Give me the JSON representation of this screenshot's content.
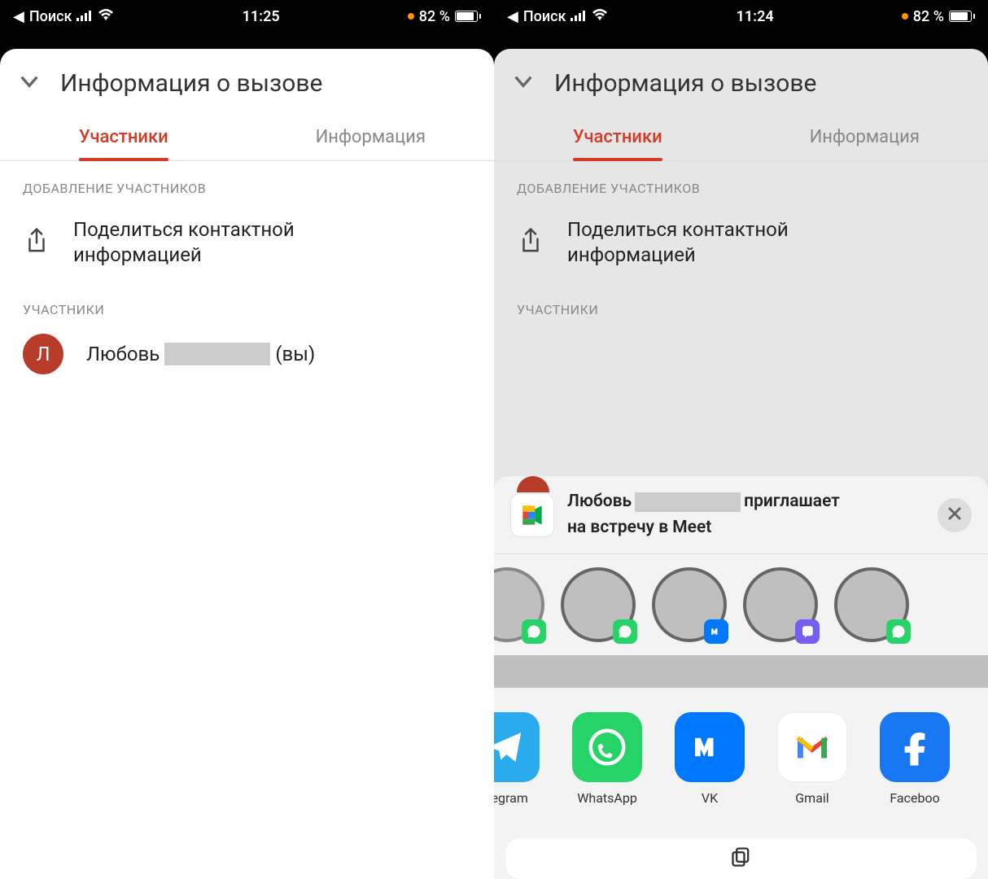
{
  "left": {
    "status": {
      "back_label": "Поиск",
      "time": "11:25",
      "battery_pct": "82 %"
    },
    "panel": {
      "title": "Информация о вызове",
      "tabs": {
        "participants": "Участники",
        "info": "Информация"
      },
      "add_section": "ДОБАВЛЕНИЕ УЧАСТНИКОВ",
      "share_line1": "Поделиться контактной",
      "share_line2": "информацией",
      "participants_section": "УЧАСТНИКИ",
      "participant": {
        "initial": "Л",
        "name": "Любовь",
        "suffix": "(вы)"
      }
    }
  },
  "right": {
    "status": {
      "back_label": "Поиск",
      "time": "11:24",
      "battery_pct": "82 %"
    },
    "panel": {
      "title": "Информация о вызове",
      "tabs": {
        "participants": "Участники",
        "info": "Информация"
      },
      "add_section": "ДОБАВЛЕНИЕ УЧАСТНИКОВ",
      "share_line1": "Поделиться контактной",
      "share_line2": "информацией",
      "participants_section": "УЧАСТНИКИ"
    },
    "share_sheet": {
      "title_prefix": "Любовь",
      "title_suffix1": "приглашает",
      "title_suffix2": "на встречу в Meet",
      "contact_badges": [
        "whatsapp",
        "whatsapp",
        "vk",
        "viber",
        "whatsapp"
      ],
      "apps": [
        {
          "id": "telegram",
          "label": "elegram"
        },
        {
          "id": "whatsapp",
          "label": "WhatsApp"
        },
        {
          "id": "vk",
          "label": "VK"
        },
        {
          "id": "gmail",
          "label": "Gmail"
        },
        {
          "id": "facebook",
          "label": "Faceboo"
        }
      ]
    }
  }
}
